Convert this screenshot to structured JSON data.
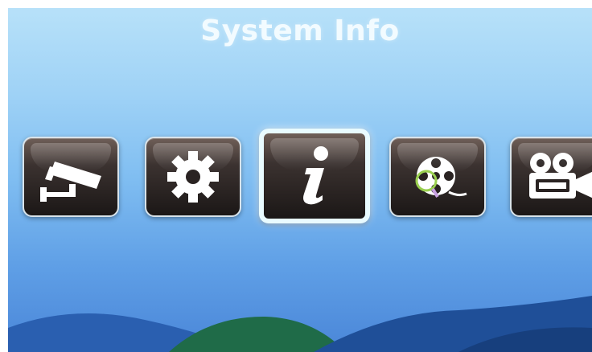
{
  "screen": {
    "title": "System Info"
  },
  "menu": {
    "items": [
      {
        "icon": "security-camera-icon"
      },
      {
        "icon": "gear-icon"
      },
      {
        "icon": "info-icon",
        "selected": true
      },
      {
        "icon": "film-reel-search-icon"
      },
      {
        "icon": "video-camera-icon"
      }
    ]
  },
  "colors": {
    "background_top": "#b7e1f9",
    "background_bottom": "#4a86d8",
    "tile_dark": "#1b1716",
    "selected_border": "#e9fbff",
    "title_text": "#f2fbff"
  }
}
